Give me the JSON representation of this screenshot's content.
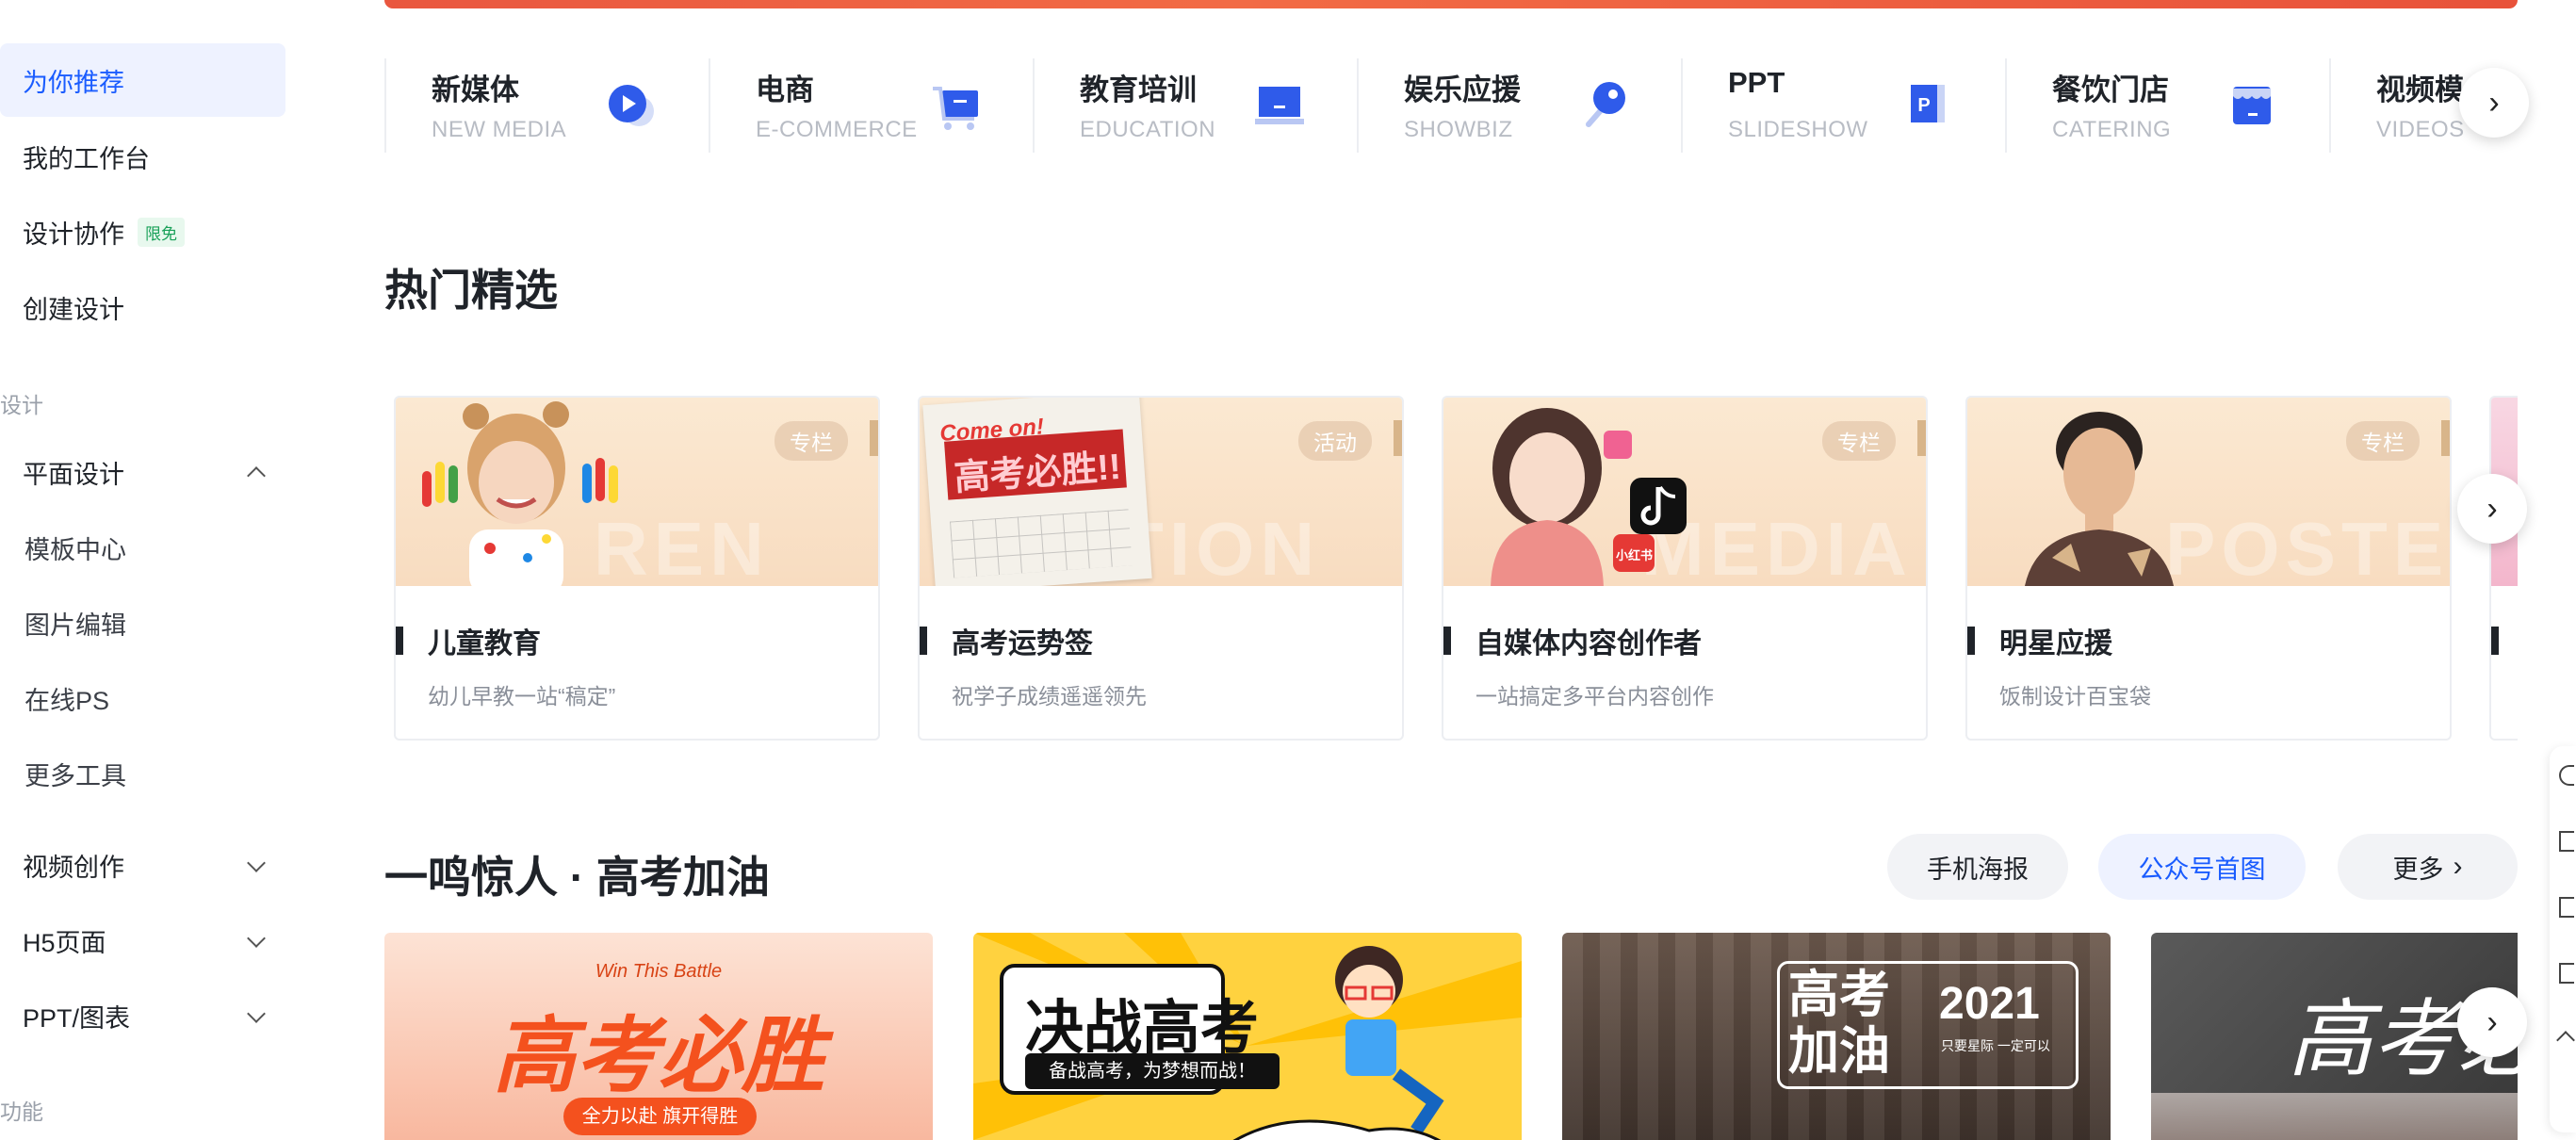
{
  "sidebar": {
    "nav": [
      {
        "label": "为你推荐",
        "active": true
      },
      {
        "label": "我的工作台"
      },
      {
        "label": "设计协作",
        "badge": "限免"
      },
      {
        "label": "创建设计"
      }
    ],
    "section_design": "设计",
    "groups": [
      {
        "label": "平面设计",
        "expanded": true,
        "children": [
          "模板中心",
          "图片编辑",
          "在线PS",
          "更多工具"
        ]
      },
      {
        "label": "视频创作",
        "expanded": false
      },
      {
        "label": "H5页面",
        "expanded": false
      },
      {
        "label": "PPT/图表",
        "expanded": false
      }
    ],
    "section_features": "功能"
  },
  "categories": [
    {
      "title": "新媒体",
      "sub": "NEW MEDIA",
      "icon": "play-chat-icon"
    },
    {
      "title": "电商",
      "sub": "E-COMMERCE",
      "icon": "cart-icon"
    },
    {
      "title": "教育培训",
      "sub": "EDUCATION",
      "icon": "board-icon"
    },
    {
      "title": "娱乐应援",
      "sub": "SHOWBIZ",
      "icon": "lollipop-icon"
    },
    {
      "title": "PPT",
      "sub": "SLIDESHOW",
      "icon": "ppt-icon"
    },
    {
      "title": "餐饮门店",
      "sub": "CATERING",
      "icon": "store-icon"
    },
    {
      "title": "视频模",
      "sub": "VIDEOS",
      "icon": "video-icon"
    }
  ],
  "hot": {
    "title": "热门精选",
    "cards": [
      {
        "tag": "专栏",
        "watermark": "REN",
        "title": "儿童教育",
        "desc": "幼儿早教一站“稿定”"
      },
      {
        "tag": "活动",
        "watermark": "TION",
        "title": "高考运势签",
        "desc": "祝学子成绩遥遥领先",
        "image_text": "高考必胜!!",
        "image_text2": "Come on!"
      },
      {
        "tag": "专栏",
        "watermark": "MEDIA",
        "title": "自媒体内容创作者",
        "desc": "一站搞定多平台内容创作",
        "image_text": "小红书"
      },
      {
        "tag": "专栏",
        "watermark": "POSTER",
        "title": "明星应援",
        "desc": "饭制设计百宝袋"
      }
    ]
  },
  "gaokao": {
    "title": "一鸣惊人 · 高考加油",
    "tabs": [
      {
        "label": "手机海报",
        "active": false
      },
      {
        "label": "公众号首图",
        "active": true
      }
    ],
    "more": "更多",
    "posters": [
      {
        "top": "Win This Battle",
        "main": "高考必胜",
        "bottom": "全力以赴  旗开得胜"
      },
      {
        "main": "决战高考",
        "bottom": "备战高考，为梦想而战！"
      },
      {
        "main": "高考加油",
        "year": "2021",
        "small": "只要星际 一定可以"
      },
      {
        "main": "高考必"
      }
    ]
  },
  "colors": {
    "accent": "#1a5cff",
    "icon_blue": "#2f5bea",
    "poster_orange": "#f26b45"
  }
}
